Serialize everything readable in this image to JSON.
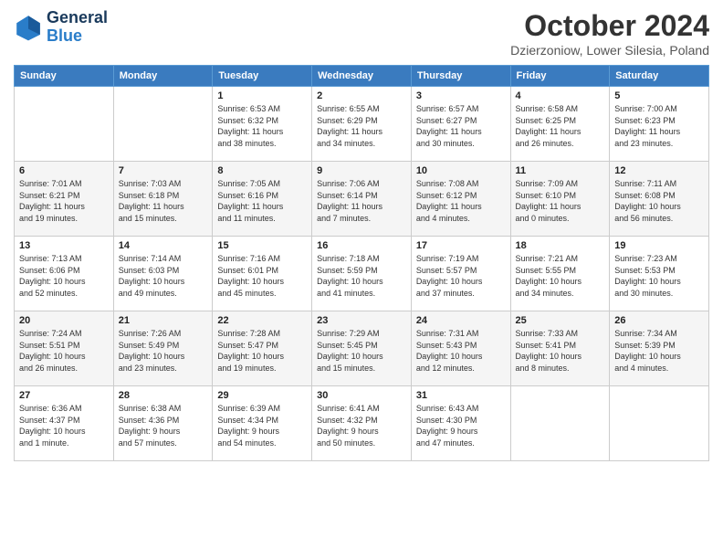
{
  "header": {
    "logo_line1": "General",
    "logo_line2": "Blue",
    "month": "October 2024",
    "location": "Dzierzoniow, Lower Silesia, Poland"
  },
  "weekdays": [
    "Sunday",
    "Monday",
    "Tuesday",
    "Wednesday",
    "Thursday",
    "Friday",
    "Saturday"
  ],
  "weeks": [
    [
      {
        "day": "",
        "info": ""
      },
      {
        "day": "",
        "info": ""
      },
      {
        "day": "1",
        "info": "Sunrise: 6:53 AM\nSunset: 6:32 PM\nDaylight: 11 hours\nand 38 minutes."
      },
      {
        "day": "2",
        "info": "Sunrise: 6:55 AM\nSunset: 6:29 PM\nDaylight: 11 hours\nand 34 minutes."
      },
      {
        "day": "3",
        "info": "Sunrise: 6:57 AM\nSunset: 6:27 PM\nDaylight: 11 hours\nand 30 minutes."
      },
      {
        "day": "4",
        "info": "Sunrise: 6:58 AM\nSunset: 6:25 PM\nDaylight: 11 hours\nand 26 minutes."
      },
      {
        "day": "5",
        "info": "Sunrise: 7:00 AM\nSunset: 6:23 PM\nDaylight: 11 hours\nand 23 minutes."
      }
    ],
    [
      {
        "day": "6",
        "info": "Sunrise: 7:01 AM\nSunset: 6:21 PM\nDaylight: 11 hours\nand 19 minutes."
      },
      {
        "day": "7",
        "info": "Sunrise: 7:03 AM\nSunset: 6:18 PM\nDaylight: 11 hours\nand 15 minutes."
      },
      {
        "day": "8",
        "info": "Sunrise: 7:05 AM\nSunset: 6:16 PM\nDaylight: 11 hours\nand 11 minutes."
      },
      {
        "day": "9",
        "info": "Sunrise: 7:06 AM\nSunset: 6:14 PM\nDaylight: 11 hours\nand 7 minutes."
      },
      {
        "day": "10",
        "info": "Sunrise: 7:08 AM\nSunset: 6:12 PM\nDaylight: 11 hours\nand 4 minutes."
      },
      {
        "day": "11",
        "info": "Sunrise: 7:09 AM\nSunset: 6:10 PM\nDaylight: 11 hours\nand 0 minutes."
      },
      {
        "day": "12",
        "info": "Sunrise: 7:11 AM\nSunset: 6:08 PM\nDaylight: 10 hours\nand 56 minutes."
      }
    ],
    [
      {
        "day": "13",
        "info": "Sunrise: 7:13 AM\nSunset: 6:06 PM\nDaylight: 10 hours\nand 52 minutes."
      },
      {
        "day": "14",
        "info": "Sunrise: 7:14 AM\nSunset: 6:03 PM\nDaylight: 10 hours\nand 49 minutes."
      },
      {
        "day": "15",
        "info": "Sunrise: 7:16 AM\nSunset: 6:01 PM\nDaylight: 10 hours\nand 45 minutes."
      },
      {
        "day": "16",
        "info": "Sunrise: 7:18 AM\nSunset: 5:59 PM\nDaylight: 10 hours\nand 41 minutes."
      },
      {
        "day": "17",
        "info": "Sunrise: 7:19 AM\nSunset: 5:57 PM\nDaylight: 10 hours\nand 37 minutes."
      },
      {
        "day": "18",
        "info": "Sunrise: 7:21 AM\nSunset: 5:55 PM\nDaylight: 10 hours\nand 34 minutes."
      },
      {
        "day": "19",
        "info": "Sunrise: 7:23 AM\nSunset: 5:53 PM\nDaylight: 10 hours\nand 30 minutes."
      }
    ],
    [
      {
        "day": "20",
        "info": "Sunrise: 7:24 AM\nSunset: 5:51 PM\nDaylight: 10 hours\nand 26 minutes."
      },
      {
        "day": "21",
        "info": "Sunrise: 7:26 AM\nSunset: 5:49 PM\nDaylight: 10 hours\nand 23 minutes."
      },
      {
        "day": "22",
        "info": "Sunrise: 7:28 AM\nSunset: 5:47 PM\nDaylight: 10 hours\nand 19 minutes."
      },
      {
        "day": "23",
        "info": "Sunrise: 7:29 AM\nSunset: 5:45 PM\nDaylight: 10 hours\nand 15 minutes."
      },
      {
        "day": "24",
        "info": "Sunrise: 7:31 AM\nSunset: 5:43 PM\nDaylight: 10 hours\nand 12 minutes."
      },
      {
        "day": "25",
        "info": "Sunrise: 7:33 AM\nSunset: 5:41 PM\nDaylight: 10 hours\nand 8 minutes."
      },
      {
        "day": "26",
        "info": "Sunrise: 7:34 AM\nSunset: 5:39 PM\nDaylight: 10 hours\nand 4 minutes."
      }
    ],
    [
      {
        "day": "27",
        "info": "Sunrise: 6:36 AM\nSunset: 4:37 PM\nDaylight: 10 hours\nand 1 minute."
      },
      {
        "day": "28",
        "info": "Sunrise: 6:38 AM\nSunset: 4:36 PM\nDaylight: 9 hours\nand 57 minutes."
      },
      {
        "day": "29",
        "info": "Sunrise: 6:39 AM\nSunset: 4:34 PM\nDaylight: 9 hours\nand 54 minutes."
      },
      {
        "day": "30",
        "info": "Sunrise: 6:41 AM\nSunset: 4:32 PM\nDaylight: 9 hours\nand 50 minutes."
      },
      {
        "day": "31",
        "info": "Sunrise: 6:43 AM\nSunset: 4:30 PM\nDaylight: 9 hours\nand 47 minutes."
      },
      {
        "day": "",
        "info": ""
      },
      {
        "day": "",
        "info": ""
      }
    ]
  ]
}
